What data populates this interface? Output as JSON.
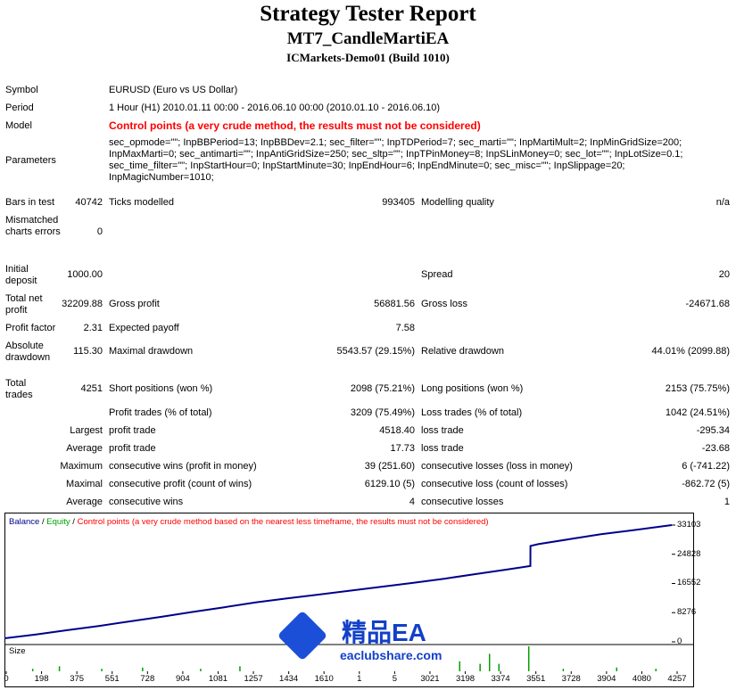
{
  "header": {
    "title": "Strategy Tester Report",
    "ea_name": "MT7_CandleMartiEA",
    "server": "ICMarkets-Demo01 (Build 1010)"
  },
  "report": {
    "symbol_label": "Symbol",
    "symbol_value": "EURUSD (Euro vs US Dollar)",
    "period_label": "Period",
    "period_value": "1 Hour (H1) 2010.01.11 00:00 - 2016.06.10 00:00 (2010.01.10 - 2016.06.10)",
    "model_label": "Model",
    "model_value": "Control points (a very crude method, the results must not be considered)",
    "parameters_label": "Parameters",
    "parameters_value": "sec_opmode=\"\"; InpBBPeriod=13; InpBBDev=2.1; sec_filter=\"\"; InpTDPeriod=7; sec_marti=\"\"; InpMartiMult=2; InpMinGridSize=200; InpMaxMarti=0; sec_antimarti=\"\"; InpAntiGridSize=250; sec_sltp=\"\"; InpTPinMoney=8; InpSLinMoney=0; sec_lot=\"\"; InpLotSize=0.1; sec_time_filter=\"\"; InpStartHour=0; InpStartMinute=30; InpEndHour=6; InpEndMinute=0; sec_misc=\"\"; InpSlippage=20; InpMagicNumber=1010;",
    "bars_label": "Bars in test",
    "bars_value": "40742",
    "ticks_label": "Ticks modelled",
    "ticks_value": "993405",
    "quality_label": "Modelling quality",
    "quality_value": "n/a",
    "mismatch_label": "Mismatched charts errors",
    "mismatch_value": "0",
    "deposit_label": "Initial deposit",
    "deposit_value": "1000.00",
    "spread_label": "Spread",
    "spread_value": "20",
    "netprofit_label": "Total net profit",
    "netprofit_value": "32209.88",
    "grossprofit_label": "Gross profit",
    "grossprofit_value": "56881.56",
    "grossloss_label": "Gross loss",
    "grossloss_value": "-24671.68",
    "pf_label": "Profit factor",
    "pf_value": "2.31",
    "payoff_label": "Expected payoff",
    "payoff_value": "7.58",
    "absdd_label": "Absolute drawdown",
    "absdd_value": "115.30",
    "maxdd_label": "Maximal drawdown",
    "maxdd_value": "5543.57 (29.15%)",
    "reldd_label": "Relative drawdown",
    "reldd_value": "44.01% (2099.88)",
    "trades_label": "Total trades",
    "trades_value": "4251",
    "short_label": "Short positions (won %)",
    "short_value": "2098 (75.21%)",
    "long_label": "Long positions (won %)",
    "long_value": "2153 (75.75%)",
    "pt_label": "Profit trades (% of total)",
    "pt_value": "3209 (75.49%)",
    "lt_label": "Loss trades (% of total)",
    "lt_value": "1042 (24.51%)",
    "largest_label": "Largest",
    "largest_pt_label": "profit trade",
    "largest_pt_value": "4518.40",
    "largest_lt_label": "loss trade",
    "largest_lt_value": "-295.34",
    "average_label": "Average",
    "average_pt_label": "profit trade",
    "average_pt_value": "17.73",
    "average_lt_label": "loss trade",
    "average_lt_value": "-23.68",
    "maximum_label": "Maximum",
    "maximum_w_label": "consecutive wins (profit in money)",
    "maximum_w_value": "39 (251.60)",
    "maximum_l_label": "consecutive losses (loss in money)",
    "maximum_l_value": "6 (-741.22)",
    "maximal_label": "Maximal",
    "maximal_p_label": "consecutive profit (count of wins)",
    "maximal_p_value": "6129.10 (5)",
    "maximal_l_label": "consecutive loss (count of losses)",
    "maximal_l_value": "-862.72 (5)",
    "avgc_label": "Average",
    "avgc_w_label": "consecutive wins",
    "avgc_w_value": "4",
    "avgc_l_label": "consecutive losses",
    "avgc_l_value": "1"
  },
  "chart_data": {
    "type": "line",
    "legend": {
      "balance": "Balance",
      "sep1": " / ",
      "equity": "Equity",
      "sep2": " / ",
      "note": "Control points (a very crude method based on the nearest less timeframe, the results must not be considered)"
    },
    "size_label": "Size",
    "y_ticks": [
      "33103",
      "24828",
      "16552",
      "8276",
      "0"
    ],
    "y_tick_values": [
      33103,
      24828,
      16552,
      8276,
      0
    ],
    "x_ticks": [
      "0",
      "198",
      "375",
      "551",
      "728",
      "904",
      "1081",
      "1257",
      "1434",
      "1610",
      "1",
      "5",
      "3021",
      "3198",
      "3374",
      "3551",
      "3728",
      "3904",
      "4080",
      "4257"
    ],
    "ylim": [
      0,
      33103
    ],
    "xlim": [
      0,
      4251
    ],
    "series": [
      {
        "name": "Balance",
        "color": "#00008b",
        "x": [
          0,
          200,
          400,
          600,
          800,
          1000,
          1200,
          1400,
          1600,
          1800,
          2000,
          2200,
          2400,
          2600,
          2800,
          3000,
          3200,
          3350,
          3351,
          3400,
          3600,
          3800,
          4000,
          4251
        ],
        "y": [
          1000,
          2100,
          3300,
          4500,
          5800,
          7100,
          8500,
          9800,
          11200,
          12300,
          13400,
          14500,
          15600,
          16700,
          17900,
          19200,
          20500,
          21500,
          27200,
          27700,
          29100,
          30500,
          31600,
          33103
        ]
      }
    ],
    "volume_color": "#00a000",
    "volume_bars": [
      {
        "x": 180,
        "v": 0.1
      },
      {
        "x": 350,
        "v": 0.2
      },
      {
        "x": 620,
        "v": 0.1
      },
      {
        "x": 880,
        "v": 0.15
      },
      {
        "x": 1250,
        "v": 0.1
      },
      {
        "x": 1500,
        "v": 0.2
      },
      {
        "x": 2900,
        "v": 0.4
      },
      {
        "x": 3030,
        "v": 0.3
      },
      {
        "x": 3090,
        "v": 0.7
      },
      {
        "x": 3150,
        "v": 0.3
      },
      {
        "x": 3340,
        "v": 1.0
      },
      {
        "x": 3560,
        "v": 0.1
      },
      {
        "x": 3900,
        "v": 0.15
      },
      {
        "x": 4150,
        "v": 0.1
      }
    ]
  },
  "watermark": {
    "text": "精品EA",
    "url": "eaclubshare.com"
  }
}
